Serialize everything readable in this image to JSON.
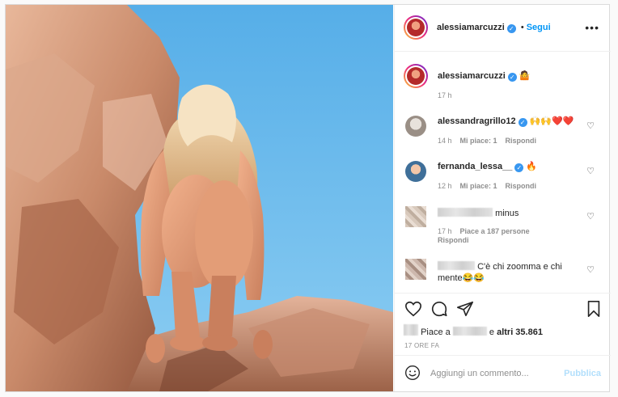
{
  "post": {
    "author": "alessiamarcuzzi",
    "follow_label": "Segui",
    "follow_separator": "•",
    "more_label": "•••",
    "caption_emoji": "🤷",
    "caption_time": "17 h"
  },
  "comments": [
    {
      "user": "alessandragrillo12",
      "text": "🙌🙌❤️❤️",
      "time": "14 h",
      "likes": "Mi piace: 1",
      "reply": "Rispondi",
      "verified": true
    },
    {
      "user": "fernanda_lessa__",
      "text": "🔥",
      "time": "12 h",
      "likes": "Mi piace: 1",
      "reply": "Rispondi",
      "verified": true
    },
    {
      "user": "",
      "text": "minus",
      "time": "17 h",
      "likes": "Piace a 187 persone",
      "reply": "Rispondi",
      "verified": false
    },
    {
      "user": "",
      "text": "C'è chi zoomma e chi mente😂😂",
      "time": "",
      "likes": "",
      "reply": "",
      "verified": false
    }
  ],
  "likes_line": {
    "prefix": "Piace a",
    "middle": "e",
    "others": "altri 35.861"
  },
  "timestamp": "17 ORE FA",
  "comment_box": {
    "placeholder": "Aggiungi un commento...",
    "publish_label": "Pubblica"
  },
  "icons": {
    "like": "heart-icon",
    "comment": "comment-icon",
    "share": "paper-plane-icon",
    "save": "bookmark-icon",
    "emoji": "smiley-icon",
    "more": "more-options-icon"
  },
  "colors": {
    "link_blue": "#0095f6",
    "verified_blue": "#3897f0",
    "publish_disabled": "#b2dffc",
    "muted_text": "#8e8e8e"
  }
}
